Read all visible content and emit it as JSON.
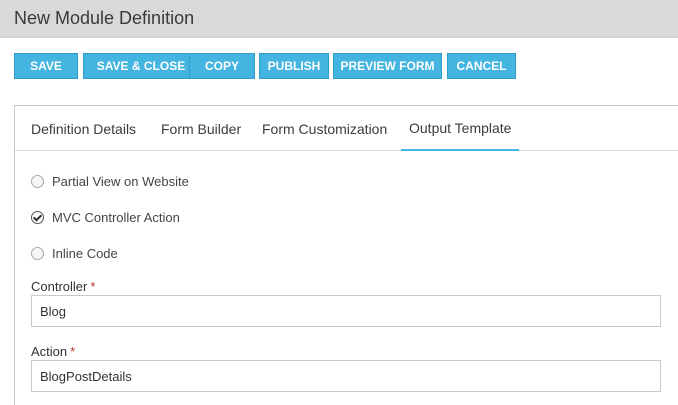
{
  "window": {
    "title": "New Module Definition"
  },
  "toolbar": {
    "save": "SAVE",
    "save_close": "SAVE & CLOSE",
    "copy": "COPY",
    "publish": "PUBLISH",
    "preview_form": "PREVIEW FORM",
    "cancel": "CANCEL"
  },
  "tabs": [
    {
      "label": "Definition Details"
    },
    {
      "label": "Form Builder"
    },
    {
      "label": "Form Customization"
    },
    {
      "label": "Output Template",
      "active": true
    }
  ],
  "output_options": [
    {
      "label": "Partial View on Website",
      "checked": false
    },
    {
      "label": "MVC Controller Action",
      "checked": true
    },
    {
      "label": "Inline Code",
      "checked": false
    }
  ],
  "fields": {
    "controller": {
      "label": "Controller",
      "required_mark": "*",
      "value": "Blog"
    },
    "action": {
      "label": "Action",
      "required_mark": "*",
      "value": "BlogPostDetails"
    }
  },
  "colors": {
    "accent": "#44b4e1",
    "title_bar": "#d9d9d9",
    "required": "#c0392b"
  }
}
